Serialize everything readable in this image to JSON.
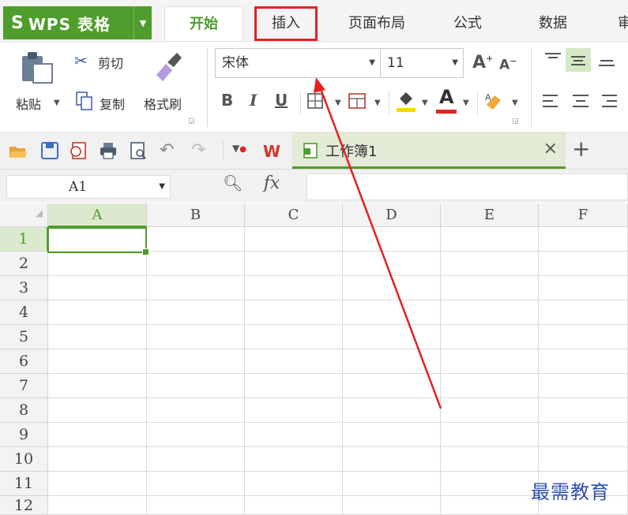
{
  "app": {
    "logo": "S",
    "title": "WPS 表格"
  },
  "menu": {
    "tabs": [
      {
        "label": "开始",
        "active": true
      },
      {
        "label": "插入",
        "highlighted": true
      },
      {
        "label": "页面布局"
      },
      {
        "label": "公式"
      },
      {
        "label": "数据"
      },
      {
        "label": "审"
      }
    ]
  },
  "ribbon": {
    "paste": "粘贴",
    "cut": "剪切",
    "copy": "复制",
    "format_painter": "格式刷",
    "font_name": "宋体",
    "font_size": "11",
    "grow_font": "A",
    "shrink_font": "A",
    "bold": "B",
    "italic": "I",
    "underline": "U",
    "font_color": "A"
  },
  "document": {
    "tab_name": "工作簿1",
    "close": "×",
    "add": "+"
  },
  "formula": {
    "name_box": "A1",
    "fx": "fx",
    "value": ""
  },
  "grid": {
    "columns": [
      "A",
      "B",
      "C",
      "D",
      "E",
      "F"
    ],
    "rows": [
      "1",
      "2",
      "3",
      "4",
      "5",
      "6",
      "7",
      "8",
      "9",
      "10",
      "11",
      "12"
    ],
    "active_cell": "A1"
  },
  "watermark": "最需教育",
  "colors": {
    "accent": "#4f9d2d",
    "highlight_box": "#e32121",
    "arrow": "#e32121"
  }
}
